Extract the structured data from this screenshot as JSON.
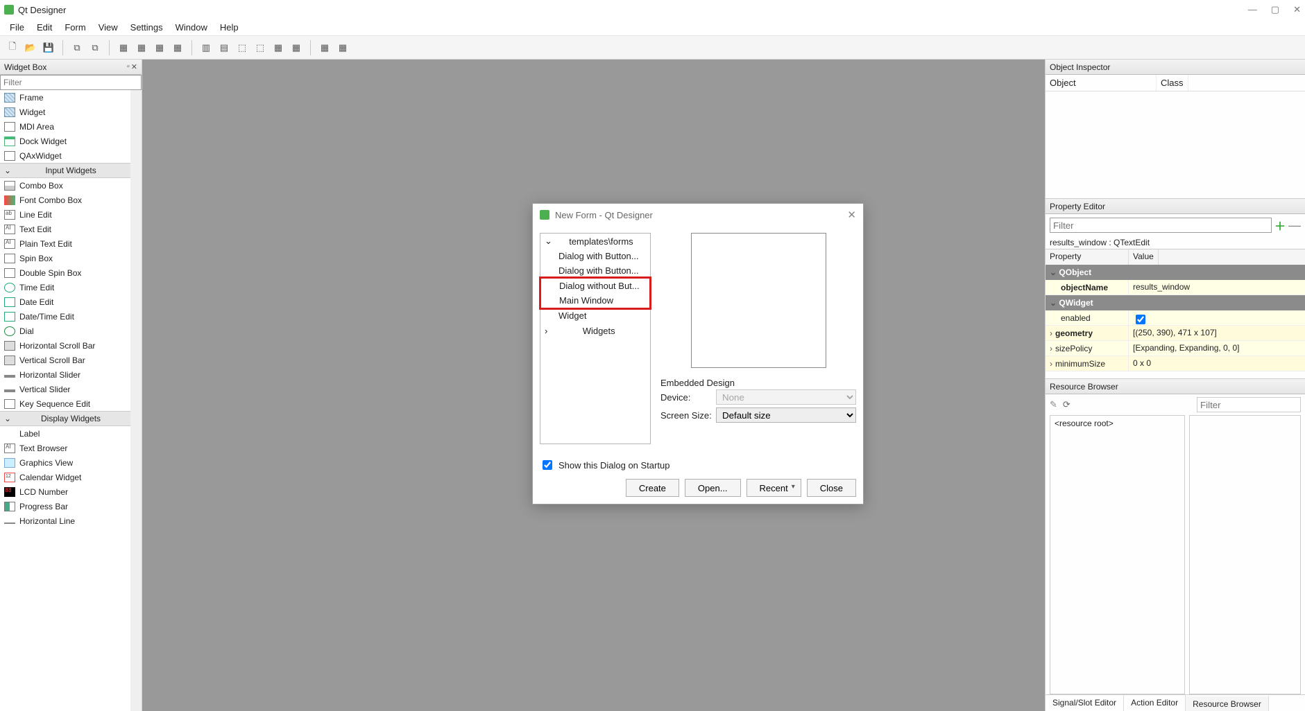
{
  "titlebar": {
    "app_title": "Qt Designer"
  },
  "menubar": {
    "items": [
      "File",
      "Edit",
      "Form",
      "View",
      "Settings",
      "Window",
      "Help"
    ]
  },
  "widget_box": {
    "title": "Widget Box",
    "filter_placeholder": "Filter",
    "items_top": [
      "Frame",
      "Widget",
      "MDI Area",
      "Dock Widget",
      "QAxWidget"
    ],
    "cat_input": "Input Widgets",
    "items_input": [
      "Combo Box",
      "Font Combo Box",
      "Line Edit",
      "Text Edit",
      "Plain Text Edit",
      "Spin Box",
      "Double Spin Box",
      "Time Edit",
      "Date Edit",
      "Date/Time Edit",
      "Dial",
      "Horizontal Scroll Bar",
      "Vertical Scroll Bar",
      "Horizontal Slider",
      "Vertical Slider",
      "Key Sequence Edit"
    ],
    "cat_display": "Display Widgets",
    "items_display": [
      "Label",
      "Text Browser",
      "Graphics View",
      "Calendar Widget",
      "LCD Number",
      "Progress Bar",
      "Horizontal Line"
    ]
  },
  "object_inspector": {
    "title": "Object Inspector",
    "col_object": "Object",
    "col_class": "Class"
  },
  "property_editor": {
    "title": "Property Editor",
    "filter_placeholder": "Filter",
    "desc": "results_window : QTextEdit",
    "col_prop": "Property",
    "col_val": "Value",
    "group1": "QObject",
    "p_objectName": "objectName",
    "v_objectName": "results_window",
    "group2": "QWidget",
    "p_enabled": "enabled",
    "p_geometry": "geometry",
    "v_geometry": "[(250, 390), 471 x 107]",
    "p_sizePolicy": "sizePolicy",
    "v_sizePolicy": "[Expanding, Expanding, 0, 0]",
    "p_minimumSize": "minimumSize",
    "v_minimumSize": "0 x 0"
  },
  "resource_browser": {
    "title": "Resource Browser",
    "filter_placeholder": "Filter",
    "root": "<resource root>"
  },
  "bottom_tabs": {
    "t1": "Signal/Slot Editor",
    "t2": "Action Editor",
    "t3": "Resource Browser"
  },
  "dialog": {
    "title": "New Form - Qt Designer",
    "tree_cat1": "templates\\forms",
    "tree_items": [
      "Dialog with Button...",
      "Dialog with Button...",
      "Dialog without But...",
      "Main Window",
      "Widget"
    ],
    "tree_cat2": "Widgets",
    "embedded_label": "Embedded Design",
    "device_label": "Device:",
    "device_value": "None",
    "screen_label": "Screen Size:",
    "screen_value": "Default size",
    "show_startup": "Show this Dialog on Startup",
    "btn_create": "Create",
    "btn_open": "Open...",
    "btn_recent": "Recent",
    "btn_close": "Close"
  }
}
